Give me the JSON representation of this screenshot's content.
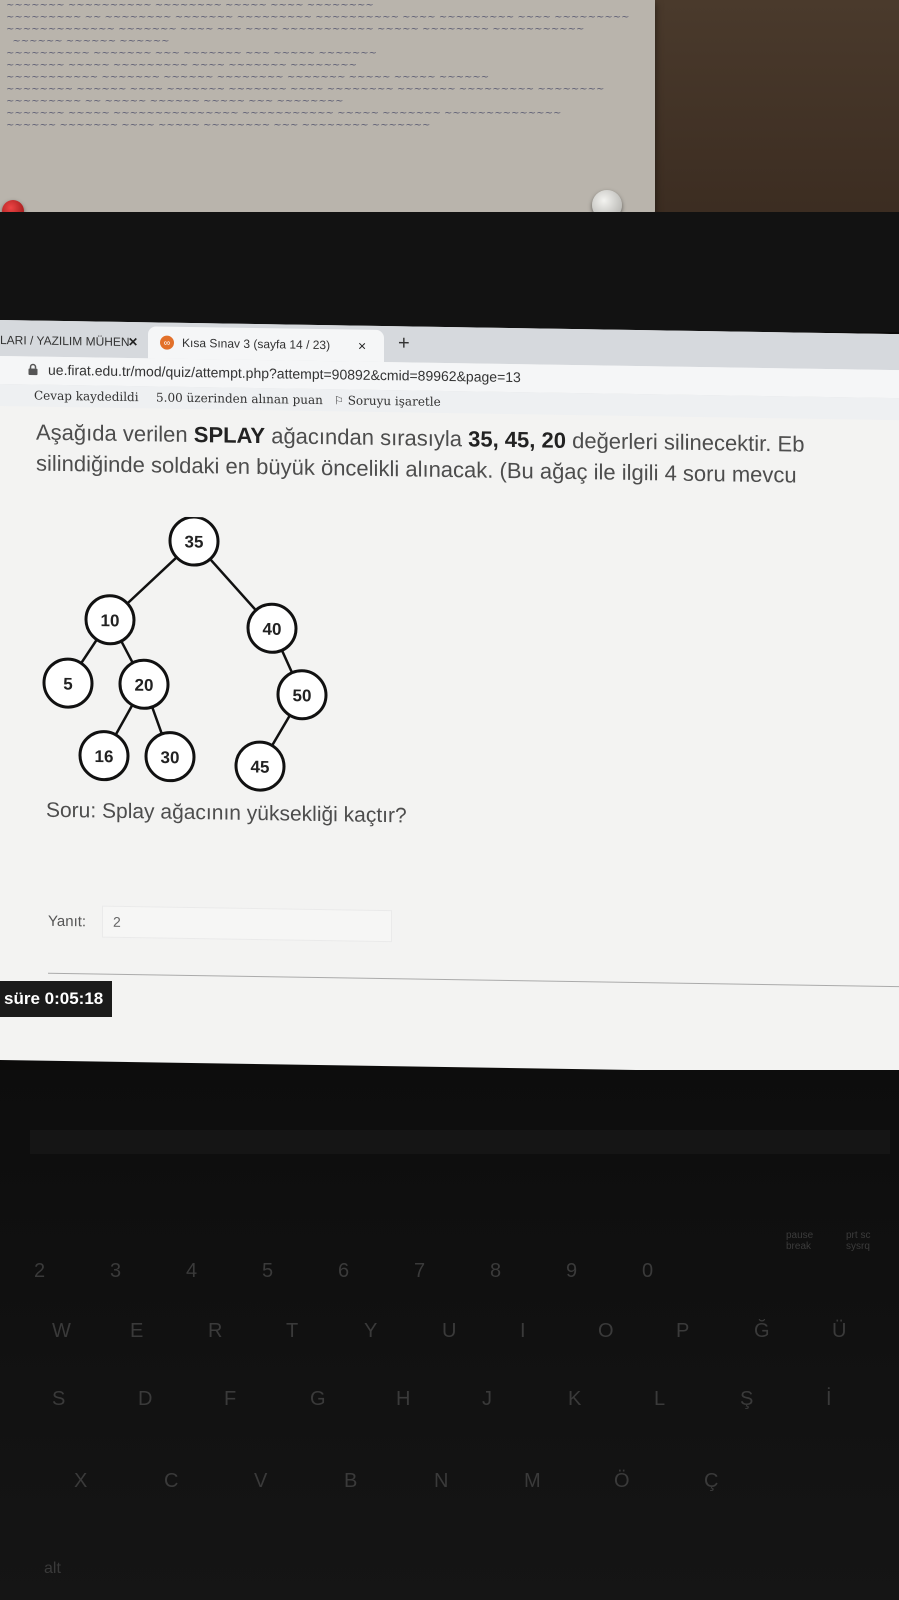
{
  "browser": {
    "inactive_tab": "LARI / YAZILIM MÜHEN",
    "inactive_tab_close": "✕",
    "active_tab": "Kısa Sınav 3 (sayfa 14 / 23)",
    "active_tab_close": "×",
    "favicon_text": "∞",
    "new_tab": "+",
    "url": "ue.firat.edu.tr/mod/quiz/attempt.php?attempt=90892&cmid=89962&page=13"
  },
  "quiz_nav": {
    "saved": "Cevap kaydedildi",
    "points": "5.00 üzerinden alınan puan",
    "flag": "Soruyu işaretle"
  },
  "question": {
    "line1_pre": "Aşağıda verilen ",
    "line1_bold1": "SPLAY",
    "line1_mid": " ağacından sırasıyla ",
    "line1_bold2": "35, 45, 20",
    "line1_post": " değerleri silinecektir. Eb",
    "line2": "silindiğinde soldaki en büyük öncelikli alınacak. (Bu ağaç ile ilgili 4 soru mevcu",
    "prompt": "Soru: Splay ağacının yüksekliği kaçtır?"
  },
  "tree": {
    "nodes": [
      {
        "id": "n35",
        "label": "35"
      },
      {
        "id": "n10",
        "label": "10"
      },
      {
        "id": "n40",
        "label": "40"
      },
      {
        "id": "n5",
        "label": "5"
      },
      {
        "id": "n20",
        "label": "20"
      },
      {
        "id": "n50",
        "label": "50"
      },
      {
        "id": "n16",
        "label": "16"
      },
      {
        "id": "n30",
        "label": "30"
      },
      {
        "id": "n45",
        "label": "45"
      }
    ],
    "edges": [
      [
        "n35",
        "n10"
      ],
      [
        "n35",
        "n40"
      ],
      [
        "n10",
        "n5"
      ],
      [
        "n10",
        "n20"
      ],
      [
        "n40",
        "n50"
      ],
      [
        "n20",
        "n16"
      ],
      [
        "n20",
        "n30"
      ],
      [
        "n50",
        "n45"
      ]
    ]
  },
  "answer": {
    "label": "Yanıt:",
    "value": "2"
  },
  "timer": {
    "label": "süre",
    "value": "0:05:18"
  },
  "keyboard": {
    "row_num": [
      "2",
      "3",
      "4",
      "5",
      "6",
      "7",
      "8",
      "9",
      "0"
    ],
    "row_top": [
      "W",
      "E",
      "R",
      "T",
      "Y",
      "U",
      "I",
      "O",
      "P",
      "Ğ",
      "Ü"
    ],
    "row_mid": [
      "S",
      "D",
      "F",
      "G",
      "H",
      "J",
      "K",
      "L",
      "Ş",
      "İ"
    ],
    "row_bot": [
      "X",
      "C",
      "V",
      "B",
      "N",
      "M",
      "Ö",
      "Ç"
    ],
    "alt": "alt",
    "pause_key": "pause break",
    "prtsc_key": "prt sc sysrq"
  }
}
